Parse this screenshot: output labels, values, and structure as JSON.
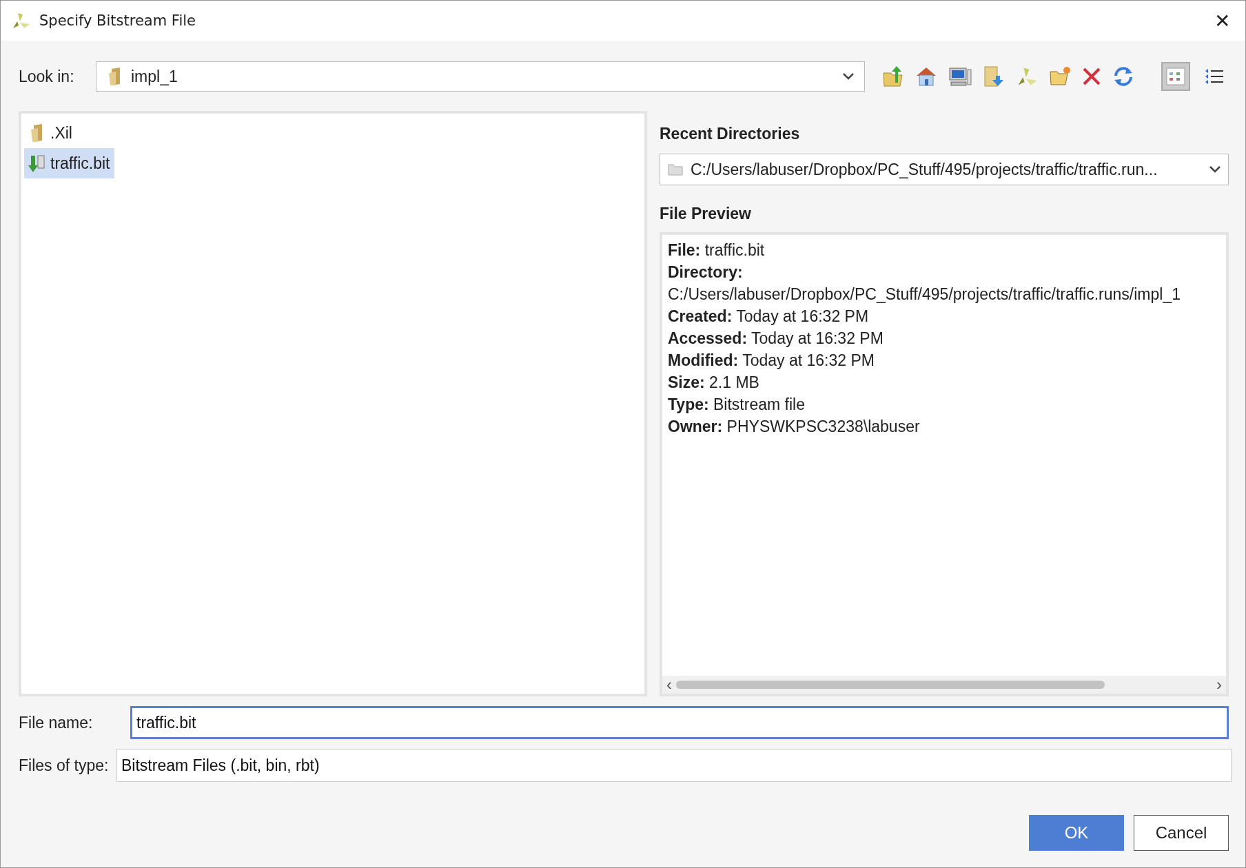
{
  "window": {
    "title": "Specify Bitstream File",
    "close": "✕"
  },
  "look_in": {
    "label": "Look in:",
    "value": "impl_1"
  },
  "view_modes": [
    {
      "kind": "list",
      "selected": true
    },
    {
      "kind": "details",
      "selected": false
    }
  ],
  "files": [
    {
      "kind": "folder",
      "name": ".Xil",
      "selected": false
    },
    {
      "kind": "bitfile",
      "name": "traffic.bit",
      "selected": true
    }
  ],
  "recent_directories": {
    "label": "Recent Directories",
    "value": "C:/Users/labuser/Dropbox/PC_Stuff/495/projects/traffic/traffic.run..."
  },
  "file_preview": {
    "label": "File Preview",
    "lines": [
      "**File:** traffic.bit",
      "**Directory:**",
      "C:/Users/labuser/Dropbox/PC_Stuff/495/projects/traffic/traffic.runs/impl_1",
      "**Created:** Today at 16:32 PM",
      "**Accessed:** Today at 16:32 PM",
      "**Modified:** Today at 16:32 PM",
      "**Size:** 2.1 MB",
      "**Type:** Bitstream file",
      "**Owner:** PHYSWKPSC3238\\labuser"
    ],
    "scroll_left": "‹",
    "scroll_right": "›"
  },
  "file_name": {
    "label": "File name:",
    "value": "traffic.bit"
  },
  "files_of_type": {
    "label": "Files of type:",
    "value": "Bitstream Files (.bit, bin, rbt)"
  },
  "buttons": [
    {
      "kind": "primary",
      "label": "OK"
    },
    {
      "kind": "secondary",
      "label": "Cancel"
    }
  ]
}
